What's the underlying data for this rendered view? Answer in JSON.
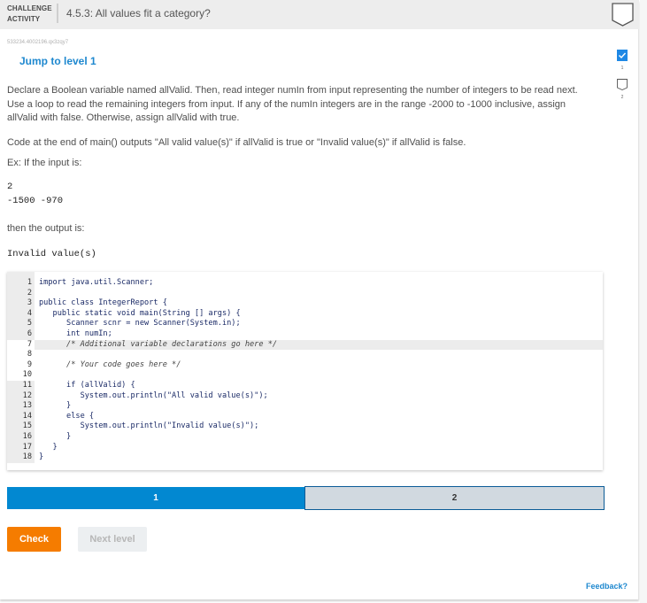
{
  "header": {
    "activity_label_line1": "CHALLENGE",
    "activity_label_line2": "ACTIVITY",
    "title": "4.5.3: All values fit a category?",
    "completion_icon": "chevron-badge-outline-icon"
  },
  "challenge_id": "533234.4002196.qx3zqy7",
  "jump_link": "Jump to level 1",
  "levels": [
    {
      "number": "1",
      "completed": true,
      "icon": "check-badge-icon"
    },
    {
      "number": "2",
      "completed": false,
      "icon": "chevron-badge-outline-icon"
    }
  ],
  "prompt": {
    "paragraph1": "Declare a Boolean variable named allValid. Then, read integer numIn from input representing the number of integers to be read next. Use a loop to read the remaining integers from input. If any of the numIn integers are in the range -2000 to -1000 inclusive, assign allValid with false. Otherwise, assign allValid with true.",
    "paragraph2": "Code at the end of main() outputs \"All valid value(s)\" if allValid is true or \"Invalid value(s)\" if allValid is false.",
    "example_intro": "Ex: If the input is:",
    "input_lines": [
      "2",
      "-1500 -970"
    ],
    "output_intro": "then the output is:",
    "output_lines": [
      "Invalid value(s)"
    ]
  },
  "code": {
    "lines": [
      {
        "n": "1",
        "text": "import java.util.Scanner;",
        "readonly": true
      },
      {
        "n": "2",
        "text": "",
        "readonly": true
      },
      {
        "n": "3",
        "text": "public class IntegerReport {",
        "readonly": true
      },
      {
        "n": "4",
        "text": "   public static void main(String [] args) {",
        "readonly": true
      },
      {
        "n": "5",
        "text": "      Scanner scnr = new Scanner(System.in);",
        "readonly": true
      },
      {
        "n": "6",
        "text": "      int numIn;",
        "readonly": true
      },
      {
        "n": "7",
        "text": "      /* Additional variable declarations go here */",
        "readonly": false,
        "comment": true,
        "active": true
      },
      {
        "n": "8",
        "text": "",
        "readonly": false
      },
      {
        "n": "9",
        "text": "      /* Your code goes here */",
        "readonly": false,
        "comment": true
      },
      {
        "n": "10",
        "text": "",
        "readonly": false
      },
      {
        "n": "11",
        "text": "      if (allValid) {",
        "readonly": true
      },
      {
        "n": "12",
        "text": "         System.out.println(\"All valid value(s)\");",
        "readonly": true
      },
      {
        "n": "13",
        "text": "      }",
        "readonly": true
      },
      {
        "n": "14",
        "text": "      else {",
        "readonly": true
      },
      {
        "n": "15",
        "text": "         System.out.println(\"Invalid value(s)\");",
        "readonly": true
      },
      {
        "n": "16",
        "text": "      }",
        "readonly": true
      },
      {
        "n": "17",
        "text": "   }",
        "readonly": true
      },
      {
        "n": "18",
        "text": "}",
        "readonly": true
      }
    ]
  },
  "progress": {
    "segments": [
      {
        "label": "1",
        "state": "current"
      },
      {
        "label": "2",
        "state": "upcoming"
      }
    ]
  },
  "buttons": {
    "check": "Check",
    "next_level": "Next level"
  },
  "feedback_link": "Feedback?",
  "colors": {
    "accent_blue": "#0288d1",
    "link_blue": "#1e88cf",
    "check_orange": "#f57c00",
    "header_bg": "#ededed"
  }
}
